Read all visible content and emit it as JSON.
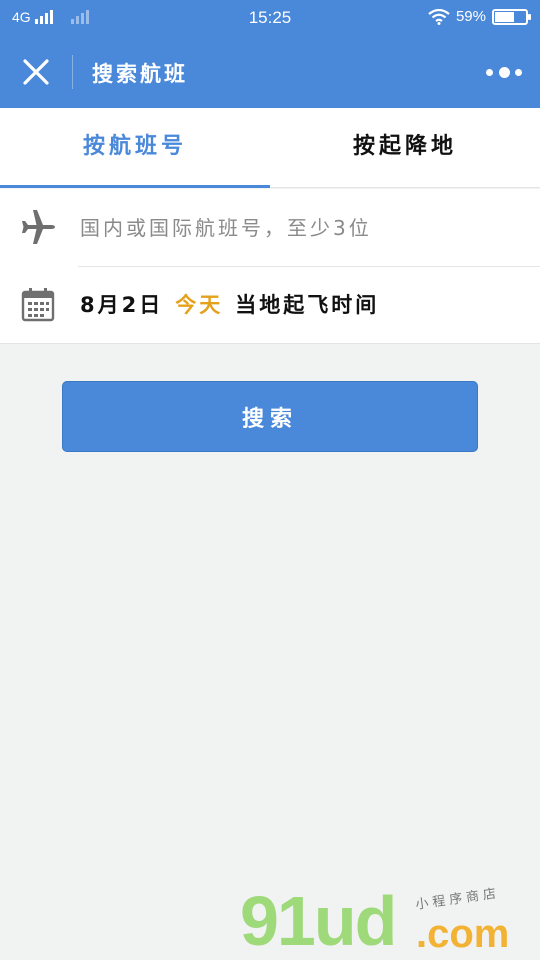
{
  "status_bar": {
    "network": "4G",
    "time": "15:25",
    "battery_percent": "59%",
    "battery_level": 0.59
  },
  "nav": {
    "title": "搜索航班",
    "close_icon": "close-icon",
    "more_icon": "more-icon"
  },
  "tabs": [
    {
      "label": "按航班号",
      "active": true
    },
    {
      "label": "按起降地",
      "active": false
    }
  ],
  "form": {
    "flight_placeholder": "国内或国际航班号，至少3位",
    "flight_value": "",
    "flight_icon": "airplane-icon",
    "date_icon": "calendar-icon",
    "date_main": "8月2日",
    "date_today": "今天",
    "date_note": "当地起飞时间"
  },
  "search_button": "搜索",
  "watermark": {
    "logo": "91ud",
    "domain": ".com",
    "tagline": "小程序商店"
  },
  "colors": {
    "primary": "#4a88d9",
    "accent_today": "#e5a11c",
    "background": "#f1f2f2"
  }
}
